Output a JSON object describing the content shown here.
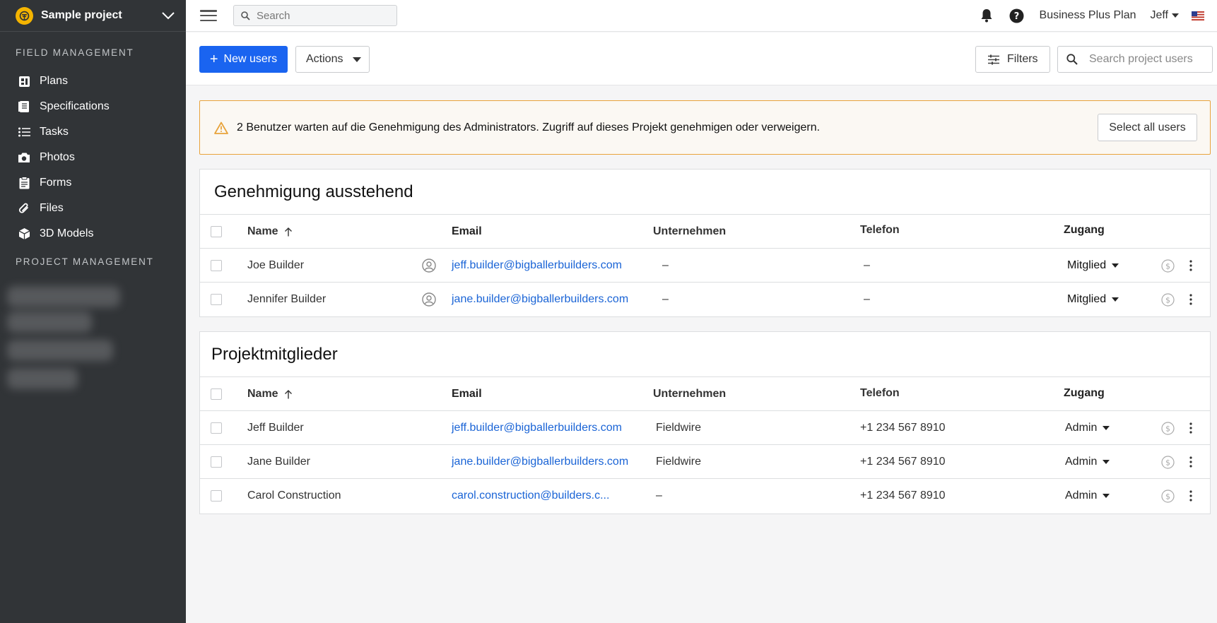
{
  "sidebar": {
    "project_name": "Sample project",
    "section_field": "FIELD MANAGEMENT",
    "section_project": "PROJECT MANAGEMENT",
    "items": [
      {
        "label": "Plans",
        "icon": "plans-icon"
      },
      {
        "label": "Specifications",
        "icon": "specifications-icon"
      },
      {
        "label": "Tasks",
        "icon": "tasks-icon"
      },
      {
        "label": "Photos",
        "icon": "camera-icon"
      },
      {
        "label": "Forms",
        "icon": "forms-icon"
      },
      {
        "label": "Files",
        "icon": "paperclip-icon"
      },
      {
        "label": "3D Models",
        "icon": "cube-icon"
      }
    ]
  },
  "topbar": {
    "search_placeholder": "Search",
    "plan": "Business Plus Plan",
    "user": "Jeff"
  },
  "toolbar": {
    "new_users_label": "New users",
    "actions_label": "Actions",
    "filters_label": "Filters",
    "search_placeholder": "Search project users"
  },
  "warning": {
    "text": "2 Benutzer warten auf die Genehmigung des Administrators. Zugriff auf dieses Projekt genehmigen oder verweigern.",
    "select_all_label": "Select all users"
  },
  "pending": {
    "title": "Genehmigung ausstehend",
    "headers": {
      "name": "Name",
      "email": "Email",
      "company": "Unternehmen",
      "phone": "Telefon",
      "access": "Zugang"
    },
    "rows": [
      {
        "name": "Joe Builder",
        "email": "jeff.builder@bigballerbuilders.com",
        "company": "–",
        "phone": "–",
        "access": "Mitglied"
      },
      {
        "name": "Jennifer Builder",
        "email": "jane.builder@bigballerbuilders.com",
        "company": "–",
        "phone": "–",
        "access": "Mitglied"
      }
    ]
  },
  "members": {
    "title": "Projektmitglieder",
    "headers": {
      "name": "Name",
      "email": "Email",
      "company": "Unternehmen",
      "phone": "Telefon",
      "access": "Zugang"
    },
    "rows": [
      {
        "name": "Jeff Builder",
        "email": "jeff.builder@bigballerbuilders.com",
        "company": "Fieldwire",
        "phone": "+1 234 567 8910",
        "access": "Admin"
      },
      {
        "name": "Jane Builder",
        "email": "jane.builder@bigballerbuilders.com",
        "company": "Fieldwire",
        "phone": "+1 234 567 8910",
        "access": "Admin"
      },
      {
        "name": "Carol Construction",
        "email": "carol.construction@builders.c...",
        "company": "–",
        "phone": "+1 234 567 8910",
        "access": "Admin"
      }
    ]
  },
  "colors": {
    "primary": "#1a64f0",
    "sidebar": "#313437",
    "warning_border": "#e8a33b",
    "link": "#1a64d6"
  }
}
